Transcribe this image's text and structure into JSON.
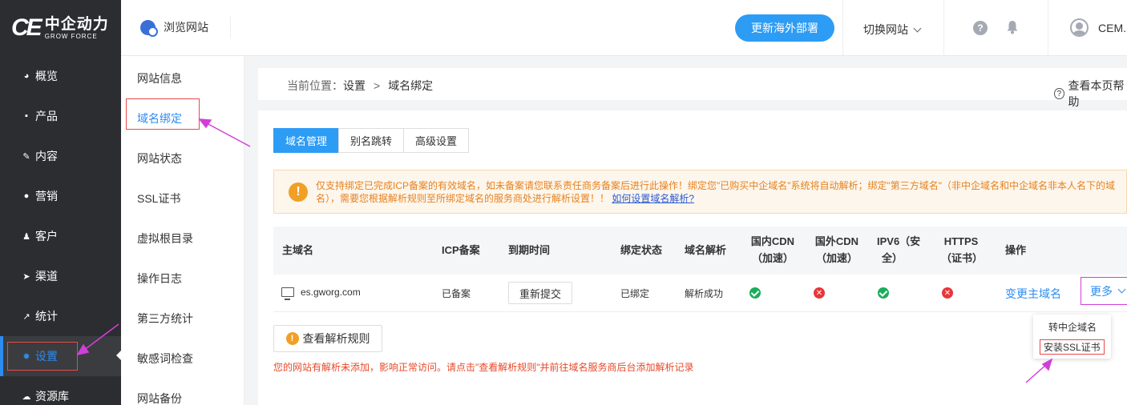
{
  "brand": {
    "logo_mark": "CE",
    "name_cn": "中企动力",
    "name_en": "GROW FORCE"
  },
  "sidebar": {
    "items": [
      {
        "label": "概览",
        "icon": "dashboard-icon"
      },
      {
        "label": "产品",
        "icon": "box-icon"
      },
      {
        "label": "内容",
        "icon": "edit-icon"
      },
      {
        "label": "营销",
        "icon": "chat-icon"
      },
      {
        "label": "客户",
        "icon": "users-icon"
      },
      {
        "label": "渠道",
        "icon": "send-icon"
      },
      {
        "label": "统计",
        "icon": "chart-icon"
      },
      {
        "label": "设置",
        "icon": "gear-icon",
        "active": true
      },
      {
        "label": "资源库",
        "icon": "cloud-icon"
      }
    ]
  },
  "header": {
    "browse_label": "浏览网站",
    "deploy_label": "更新海外部署",
    "switch_label": "切换网站",
    "user_label": "CEM."
  },
  "submenu": {
    "items": [
      "网站信息",
      "域名绑定",
      "网站状态",
      "SSL证书",
      "虚拟根目录",
      "操作日志",
      "第三方统计",
      "敏感词检查",
      "网站备份"
    ],
    "active_index": 1
  },
  "breadcrumb": {
    "prefix": "当前位置：",
    "parent": "设置",
    "separator": ">",
    "current": "域名绑定"
  },
  "help_link": "查看本页帮助",
  "tabs": [
    "域名管理",
    "别名跳转",
    "高级设置"
  ],
  "notice": {
    "text": "仅支持绑定已完成ICP备案的有效域名，如未备案请您联系责任商务备案后进行此操作！绑定您\"已购买中企域名\"系统将自动解析；绑定\"第三方域名\"（非中企域名和中企域名非本人名下的域名），需要您根据解析规则至所绑定域名的服务商处进行解析设置！！",
    "link": "如何设置域名解析?"
  },
  "table": {
    "headers": {
      "domain": "主域名",
      "icp": "ICP备案",
      "expire": "到期时间",
      "bind_status": "绑定状态",
      "resolve": "域名解析",
      "cdn_cn_1": "国内CDN",
      "cdn_cn_2": "（加速）",
      "cdn_intl_1": "国外CDN",
      "cdn_intl_2": "（加速）",
      "ipv6_1": "IPV6（安",
      "ipv6_2": "全）",
      "https_1": "HTTPS",
      "https_2": "（证书）",
      "ops": "操作"
    },
    "row": {
      "domain": "es.gworg.com",
      "icp": "已备案",
      "resubmit": "重新提交",
      "bind_status": "已绑定",
      "resolve": "解析成功",
      "cdn_cn": "ok",
      "cdn_intl": "error",
      "ipv6": "ok",
      "https": "error",
      "change_domain": "变更主域名",
      "more": "更多"
    }
  },
  "rules_button": "查看解析规则",
  "warning": "您的网站有解析未添加，影响正常访问。请点击\"查看解析规则\"并前往域名服务商后台添加解析记录",
  "more_menu": [
    "转中企域名",
    "安装SSL证书"
  ],
  "colors": {
    "accent": "#2d9cf5",
    "annotation": "#d23fd8",
    "ok": "#1aad5a",
    "error": "#e8363a",
    "warning": "#e6821f"
  }
}
